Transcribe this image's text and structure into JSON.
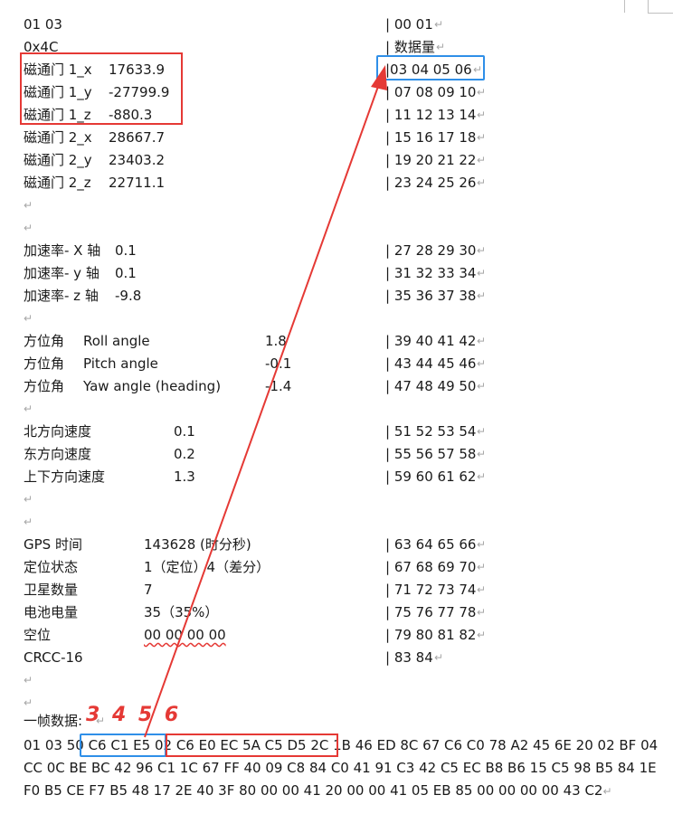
{
  "header": {
    "col1": "01 03",
    "col2": "| 00 01"
  },
  "header2": {
    "col1": "0x4C",
    "col2": "|  数据量"
  },
  "mag": [
    {
      "label": "磁通门 1_x",
      "value": "17633.9",
      "bytes": "|03 04 05 06"
    },
    {
      "label": "磁通门 1_y",
      "value": "-27799.9",
      "bytes": "| 07 08 09 10"
    },
    {
      "label": "磁通门 1_z",
      "value": "-880.3",
      "bytes": "| 11 12 13 14"
    },
    {
      "label": "磁通门 2_x",
      "value": "28667.7",
      "bytes": "| 15 16 17 18"
    },
    {
      "label": "磁通门 2_y",
      "value": "23403.2",
      "bytes": "| 19 20 21 22"
    },
    {
      "label": "磁通门 2_z",
      "value": "22711.1",
      "bytes": "| 23 24 25 26"
    }
  ],
  "accel": [
    {
      "label": "加速率- X 轴",
      "value": "0.1",
      "bytes": "| 27 28 29 30"
    },
    {
      "label": "加速率- y 轴",
      "value": "0.1",
      "bytes": "| 31 32 33 34"
    },
    {
      "label": "加速率- z 轴",
      "value": "-9.8",
      "bytes": "| 35 36 37 38"
    }
  ],
  "angle": [
    {
      "label": "方位角",
      "name": "Roll angle",
      "value": "1.8",
      "bytes": "| 39 40 41 42"
    },
    {
      "label": "方位角",
      "name": "Pitch angle",
      "value": "-0.1",
      "bytes": "| 43 44 45 46"
    },
    {
      "label": "方位角",
      "name": "Yaw angle (heading)",
      "value": "-1.4",
      "bytes": "| 47 48 49 50"
    }
  ],
  "speed": [
    {
      "label": "北方向速度",
      "value": "0.1",
      "bytes": "| 51 52 53 54"
    },
    {
      "label": "东方向速度",
      "value": "0.2",
      "bytes": "| 55 56 57 58"
    },
    {
      "label": "上下方向速度",
      "value": "1.3",
      "bytes": "| 59 60 61 62"
    }
  ],
  "gps": [
    {
      "label": "GPS 时间",
      "value": "143628   (时分秒)",
      "bytes": "| 63 64 65 66"
    },
    {
      "label": "定位状态",
      "value": "1（定位）4（差分）",
      "bytes": "| 67 68 69 70"
    },
    {
      "label": "卫星数量",
      "value": "7",
      "bytes": "| 71 72 73 74"
    },
    {
      "label": "电池电量",
      "value": "35（35%）",
      "bytes": "| 75 76 77 78"
    },
    {
      "label": "空位",
      "value": "00 00 00 00",
      "bytes": "| 79 80 81 82"
    },
    {
      "label": "CRCC-16",
      "value": "",
      "bytes": "| 83 84"
    }
  ],
  "frame": {
    "label": "一帧数据:",
    "annotation": "3 4 5 6",
    "line1_pre": "01 03 50 ",
    "line1_blue": "C6 C1 E5 02",
    "line1_red": "C6 E0 EC 5A C5 D5 2C 1B",
    "line1_post": "46 ED 8C 67 C6 C0 78 A2 45 6E 20 02 BF 04",
    "line2": "CC 0C BE BC 42 96 C1 1C 67 FF 40 09 C8 84 C0 41 91 C3 42 C5 EC B8 B6 15 C5 98 B5 84 1E",
    "line3": "F0 B5 CE F7 B5 48 17 2E 40 3F 80 00 00 41 20 00 00 41 05 EB 85 00 00 00 00 43 C2"
  },
  "para_mark": "↵"
}
